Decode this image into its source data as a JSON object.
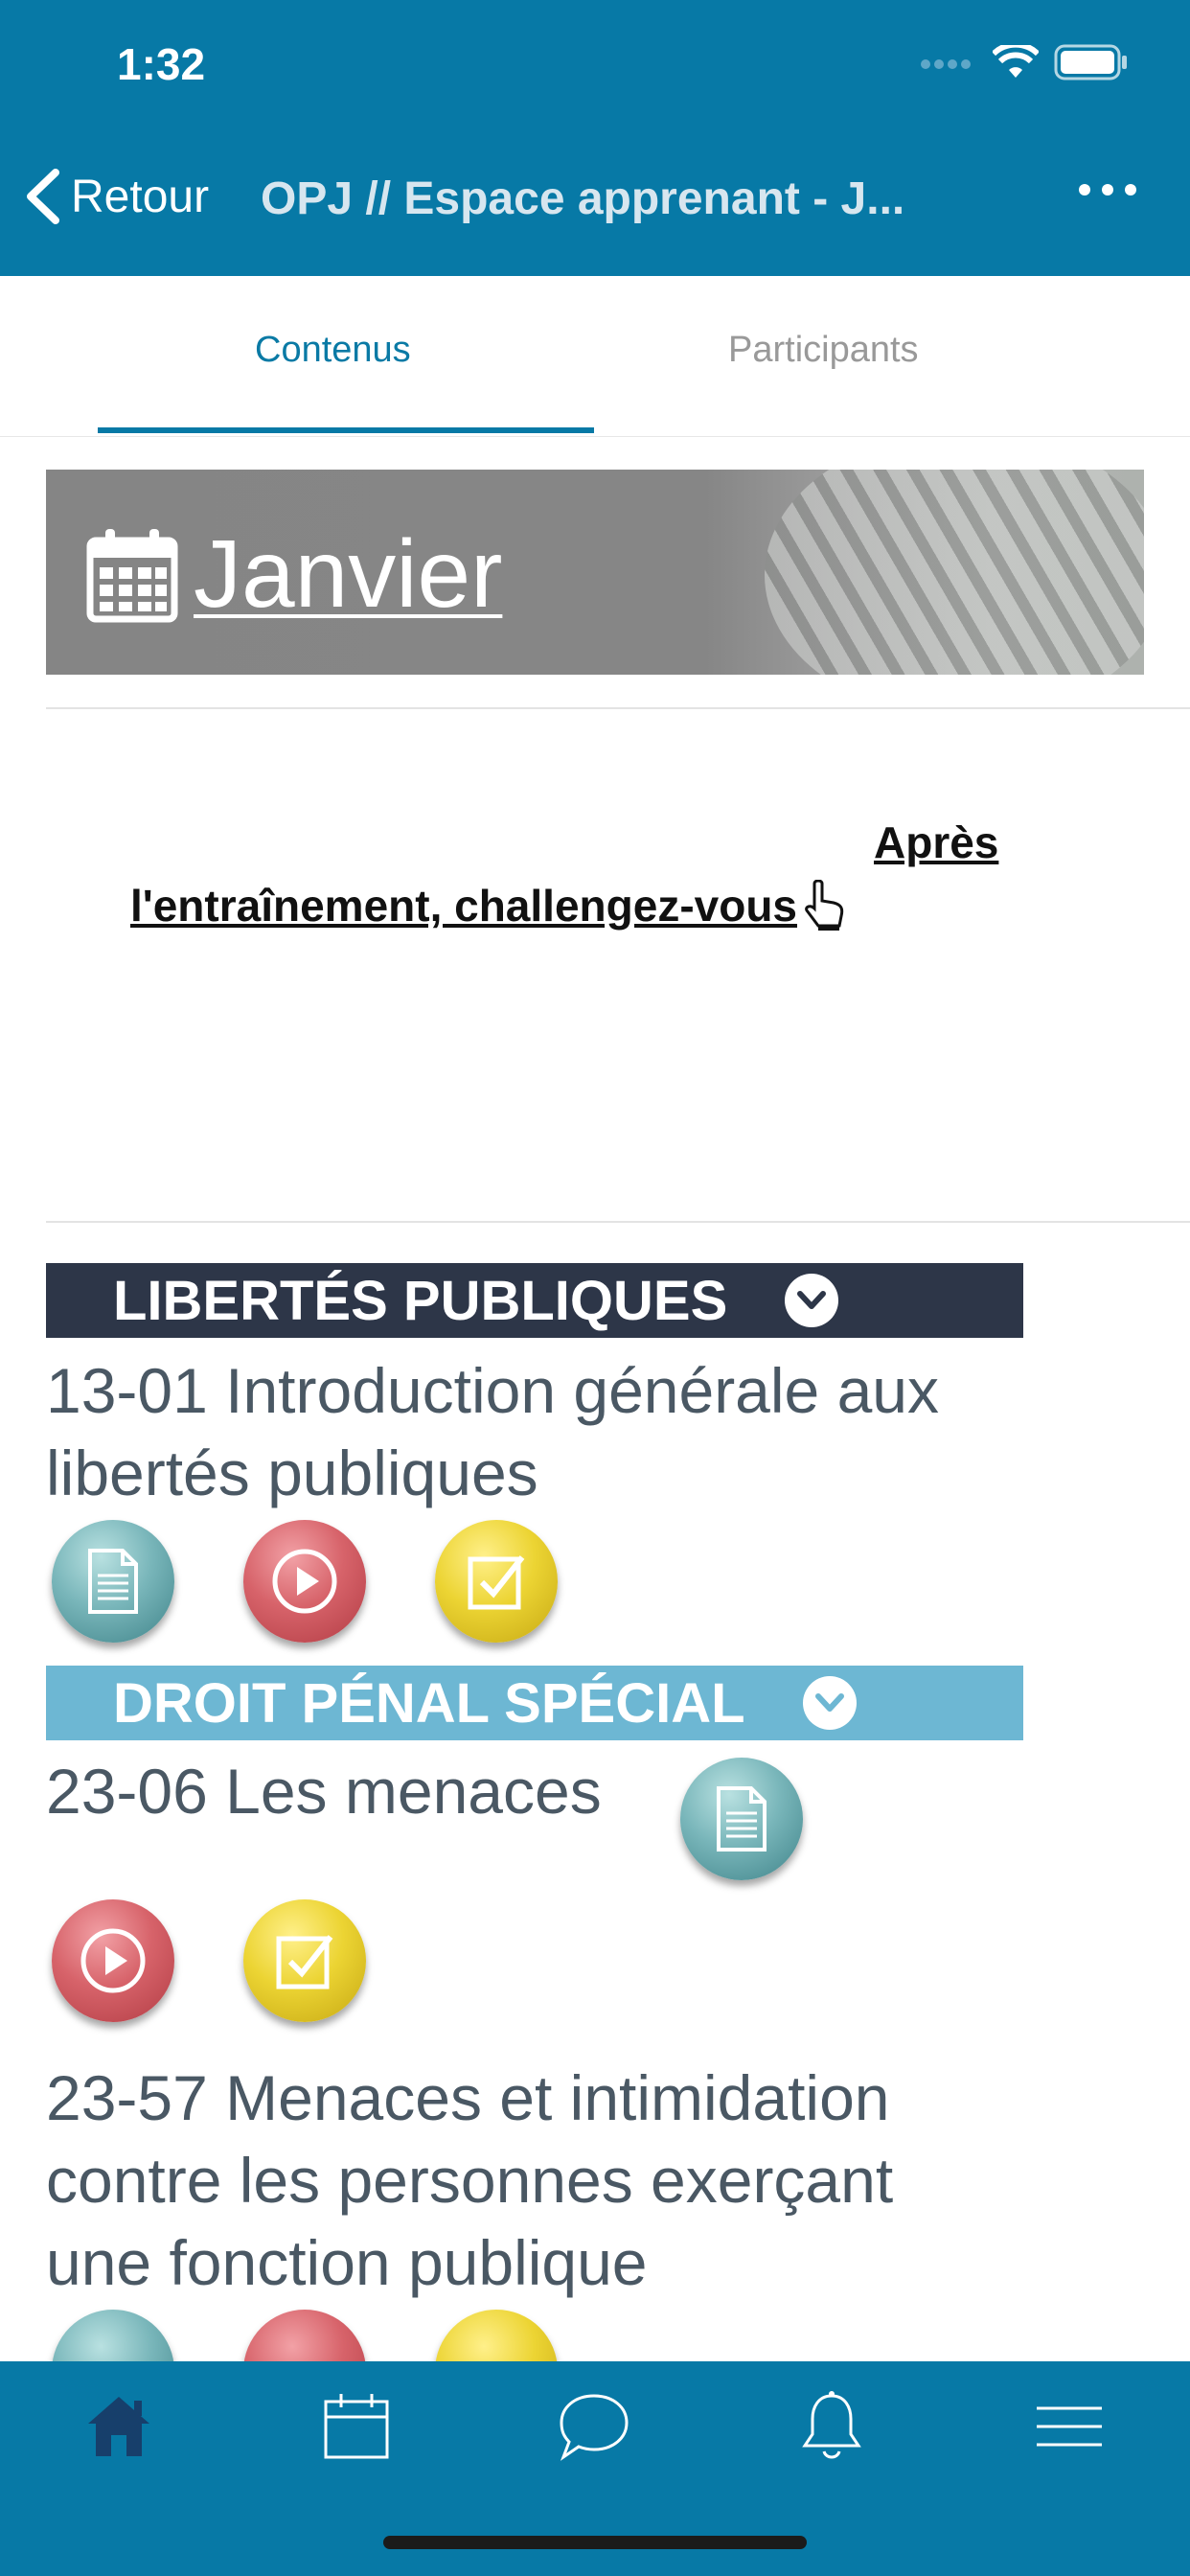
{
  "status_bar": {
    "time": "1:32"
  },
  "nav": {
    "back_label": "Retour",
    "title": "OPJ // Espace apprenant - J..."
  },
  "tabs": {
    "contenus": "Contenus",
    "participants": "Participants"
  },
  "banner": {
    "title": "Janvier"
  },
  "challenge": {
    "line1": "Après",
    "line2": "l'entraînement, challengez-vous "
  },
  "sections": [
    {
      "title": "LIBERTÉS PUBLIQUES",
      "color": "#2d3648"
    },
    {
      "title": "DROIT PÉNAL SPÉCIAL",
      "color": "#6db7d3"
    }
  ],
  "items": [
    {
      "title_line1": "13-01  Introduction générale aux",
      "title_line2": "libertés publiques"
    },
    {
      "title_line1": "23-06   Les menaces"
    },
    {
      "title_line1": "23-57   Menaces et intimidation",
      "title_line2": "contre les personnes exerçant",
      "title_line3": "une fonction publique"
    }
  ],
  "icons": {
    "doc": "document-icon",
    "play": "play-icon",
    "check": "checkbox-icon"
  },
  "bottom_nav": [
    "home-icon",
    "calendar-icon",
    "chat-icon",
    "bell-icon",
    "menu-icon"
  ],
  "colors": {
    "primary": "#0779a6",
    "active_tab": "#0a7aa5",
    "dark_section": "#2d3648",
    "light_section": "#6db7d3"
  }
}
